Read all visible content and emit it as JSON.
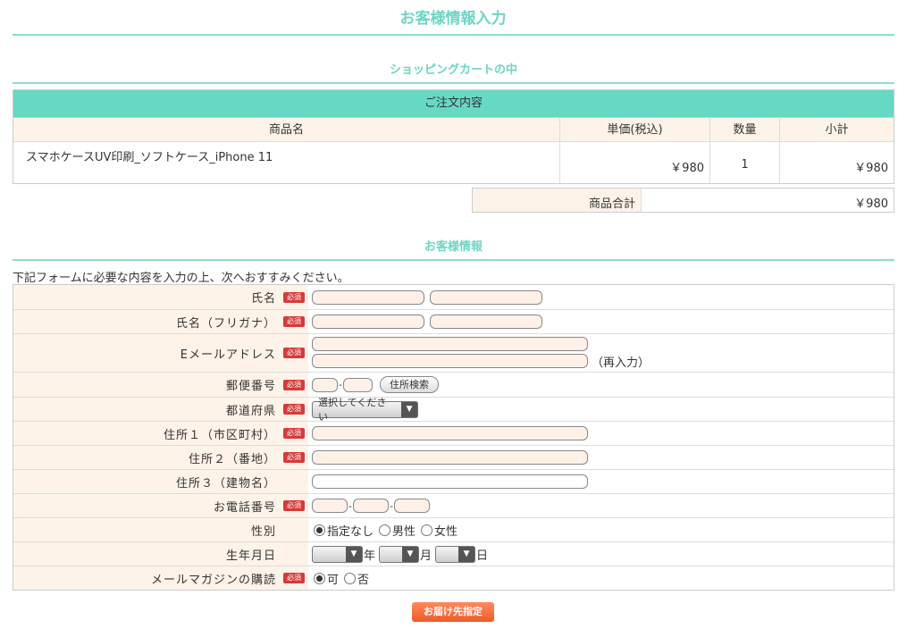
{
  "page_title": "お客様情報入力",
  "cart": {
    "section_title": "ショッピングカートの中",
    "caption": "ご注文内容",
    "headers": [
      "商品名",
      "単価(税込)",
      "数量",
      "小計"
    ],
    "item": {
      "name": "スマホケースUV印刷_ソフトケース_iPhone 11",
      "price": "￥980",
      "qty": "1",
      "subtotal": "￥980"
    },
    "total_label": "商品合計",
    "total_value": "￥980"
  },
  "customer": {
    "section_title": "お客様情報",
    "intro": "下記フォームに必要な内容を入力の上、次へおすすみください。",
    "required_badge": "必須",
    "rows": {
      "name": "氏名",
      "kana": "氏名（フリガナ）",
      "email": "Eメールアドレス",
      "email_reenter": "（再入力）",
      "zip": "郵便番号",
      "zip_search": "住所検索",
      "pref": "都道府県",
      "pref_select": "選択してください",
      "addr1": "住所１（市区町村）",
      "addr2": "住所２（番地）",
      "addr3": "住所３（建物名）",
      "tel": "お電話番号",
      "gender": "性別",
      "gender_opts": [
        "指定なし",
        "男性",
        "女性"
      ],
      "birth": "生年月日",
      "birth_units": [
        "年",
        "月",
        "日"
      ],
      "mag": "メールマガジンの購読",
      "mag_opts": [
        "可",
        "否"
      ]
    }
  },
  "submit_label": "お届け先指定"
}
